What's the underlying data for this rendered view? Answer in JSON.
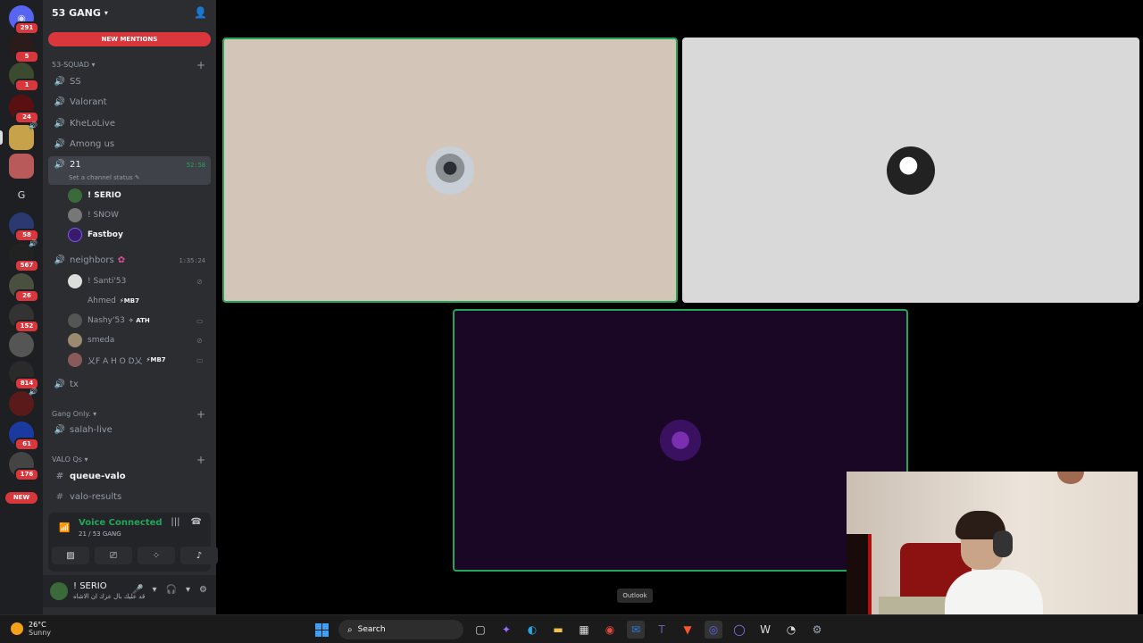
{
  "rail": {
    "home_badge": "291",
    "servers": [
      {
        "badge": "5"
      },
      {
        "badge": "1"
      },
      {
        "badge": "24"
      },
      {
        "badge": ""
      },
      {
        "badge": ""
      },
      {
        "letter": "G",
        "badge": ""
      },
      {
        "badge": "58"
      },
      {
        "badge": "567"
      },
      {
        "badge": "26"
      },
      {
        "badge": "152"
      },
      {
        "badge": ""
      },
      {
        "badge": "814"
      },
      {
        "badge": ""
      },
      {
        "badge": "61"
      },
      {
        "badge": "176"
      }
    ],
    "new_label": "NEW"
  },
  "server": {
    "name": "53 GANG",
    "new_mentions": "NEW MENTIONS"
  },
  "categories": {
    "squad": "53-SQUAD",
    "gang_only": "Gang Only.",
    "valo": "VALO Qs"
  },
  "channels": {
    "ss": "SS",
    "valorant": "Valorant",
    "khelolive": "KheLoLive",
    "among_us": "Among us",
    "c21": "21",
    "c21_time": "52:58",
    "c21_status": "Set a channel status",
    "neighbors": "neighbors",
    "neighbors_time": "1:35:24",
    "tx": "tx",
    "salah_live": "salah-live",
    "queue_valo": "queue-valo",
    "valo_results": "valo-results"
  },
  "voice_users_21": [
    "! SERIO",
    "! SNOW",
    "Fastboy"
  ],
  "voice_users_neighbors": [
    {
      "name": "! Santi'53",
      "tag": ""
    },
    {
      "name": "Ahmed",
      "tag": "⚡MB7"
    },
    {
      "name": "Nashy'53",
      "tag": "✧ ATH"
    },
    {
      "name": "smeda",
      "tag": ""
    },
    {
      "name": "乂F A H O D乂",
      "tag": "⚡MB7"
    }
  ],
  "voice_panel": {
    "status": "Voice Connected",
    "location": "21 / 53 GANG"
  },
  "user": {
    "name": "! SERIO",
    "status": "قد عليك بال عزك ان الاشاه"
  },
  "tooltip": "Outlook",
  "taskbar": {
    "temp": "26°C",
    "condition": "Sunny",
    "search": "Search"
  }
}
